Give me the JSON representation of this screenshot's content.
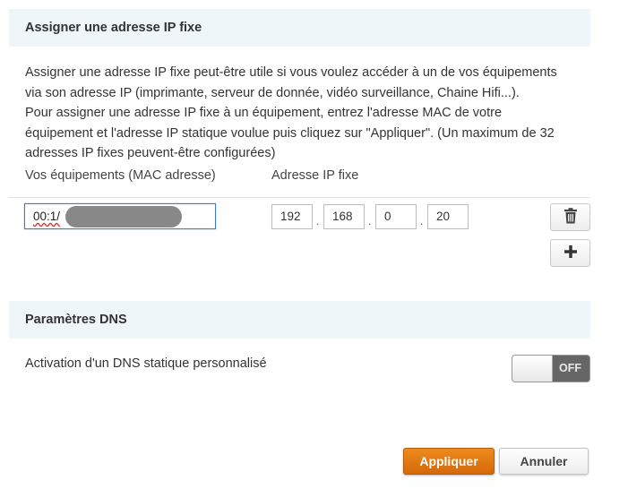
{
  "ip_section": {
    "title": "Assigner une adresse IP fixe",
    "description_lines": [
      "Assigner une adresse IP fixe peut-être utile si vous voulez accéder à un de vos équipements",
      "via son adresse IP (imprimante, serveur de donnée, vidéo surveillance, Chaine Hifi...).",
      "Pour assigner une adresse IP fixe à un équipement, entrez l'adresse MAC de votre",
      "équipement et l'adresse IP statique voulue puis cliquez sur \"Appliquer\". (Un maximum de 32",
      "adresses IP fixes peuvent-être configurées)"
    ],
    "col_mac_label": "Vos équipements (MAC adresse)",
    "col_ip_label": "Adresse IP fixe",
    "entry": {
      "mac_value": "00:1/",
      "ip_octets": [
        "192",
        "168",
        "0",
        "20"
      ]
    },
    "delete_icon": "trash-icon",
    "add_icon": "plus-icon"
  },
  "dns_section": {
    "title": "Paramètres DNS",
    "toggle_label": "Activation d'un DNS statique personnalisé",
    "toggle_state": "OFF"
  },
  "actions": {
    "apply_label": "Appliquer",
    "cancel_label": "Annuler"
  },
  "colors": {
    "header_bg": "#eef6fa",
    "apply_orange": "#e07a12",
    "focus_blue": "#3c7fd1"
  }
}
